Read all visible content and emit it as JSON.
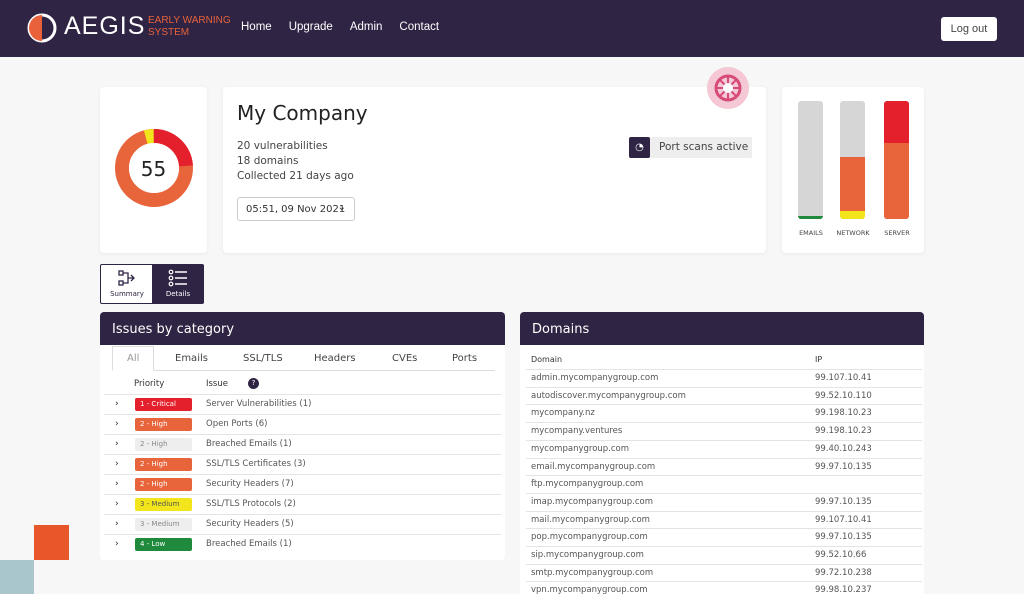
{
  "header": {
    "brand": "AEGIS",
    "brand_sub": "EARLY WARNING SYSTEM",
    "nav": [
      "Home",
      "Upgrade",
      "Admin",
      "Contact"
    ],
    "logout": "Log out",
    "colors": {
      "navy": "#302444",
      "accent": "#e8613a"
    }
  },
  "score": {
    "value": "55"
  },
  "company": {
    "name": "My Company",
    "vulnerabilities": "20 vulnerabilities",
    "domains": "18 domains",
    "collected": "Collected 21 days ago",
    "date": "05:51, 09 Nov 2021",
    "port_scans": "Port scans active"
  },
  "category_bars": [
    {
      "label": "EMAILS",
      "level": "green sliver at base, rest grey"
    },
    {
      "label": "NETWORK",
      "level": "yellow + orange about half"
    },
    {
      "label": "SERVER",
      "level": "orange with red top, full"
    }
  ],
  "view_toggle": {
    "summary": "Summary",
    "details": "Details"
  },
  "issues": {
    "title": "Issues by category",
    "tabs": [
      "All",
      "Emails",
      "SSL/TLS",
      "Headers",
      "CVEs",
      "Ports"
    ],
    "col_priority": "Priority",
    "col_issue": "Issue",
    "help_icon": "?",
    "rows": [
      {
        "priority": "1 - Critical",
        "issue": "Server Vulnerabilities (1)",
        "color": "#e3202b"
      },
      {
        "priority": "2 - High",
        "issue": "Open Ports (6)",
        "color": "#e8643a"
      },
      {
        "priority": "2 - High",
        "issue": "Breached Emails (1)",
        "color": "#eeeeee"
      },
      {
        "priority": "2 - High",
        "issue": "SSL/TLS Certificates (3)",
        "color": "#e8643a"
      },
      {
        "priority": "2 - High",
        "issue": "Security Headers (7)",
        "color": "#e8643a"
      },
      {
        "priority": "3 - Medium",
        "issue": "SSL/TLS Protocols (2)",
        "color": "#f2e51c"
      },
      {
        "priority": "3 - Medium",
        "issue": "Security Headers (5)",
        "color": "#eeeeee"
      },
      {
        "priority": "4 - Low",
        "issue": "Breached Emails (1)",
        "color": "#1f8a3c"
      }
    ]
  },
  "domains": {
    "title": "Domains",
    "col_domain": "Domain",
    "col_ip": "IP",
    "rows": [
      {
        "domain": "admin.mycompanygroup.com",
        "ip": "99.107.10.41"
      },
      {
        "domain": "autodiscover.mycompanygroup.com",
        "ip": "99.52.10.110"
      },
      {
        "domain": "mycompany.nz",
        "ip": "99.198.10.23"
      },
      {
        "domain": "mycompany.ventures",
        "ip": "99.198.10.23"
      },
      {
        "domain": "mycompanygroup.com",
        "ip": "99.40.10.243"
      },
      {
        "domain": "email.mycompanygroup.com",
        "ip": "99.97.10.135"
      },
      {
        "domain": "ftp.mycompanygroup.com",
        "ip": ""
      },
      {
        "domain": "imap.mycompanygroup.com",
        "ip": "99.97.10.135"
      },
      {
        "domain": "mail.mycompanygroup.com",
        "ip": "99.107.10.41"
      },
      {
        "domain": "pop.mycompanygroup.com",
        "ip": "99.97.10.135"
      },
      {
        "domain": "sip.mycompanygroup.com",
        "ip": "99.52.10.66"
      },
      {
        "domain": "smtp.mycompanygroup.com",
        "ip": "99.72.10.238"
      },
      {
        "domain": "vpn.mycompanygroup.com",
        "ip": "99.98.10.237"
      }
    ]
  }
}
